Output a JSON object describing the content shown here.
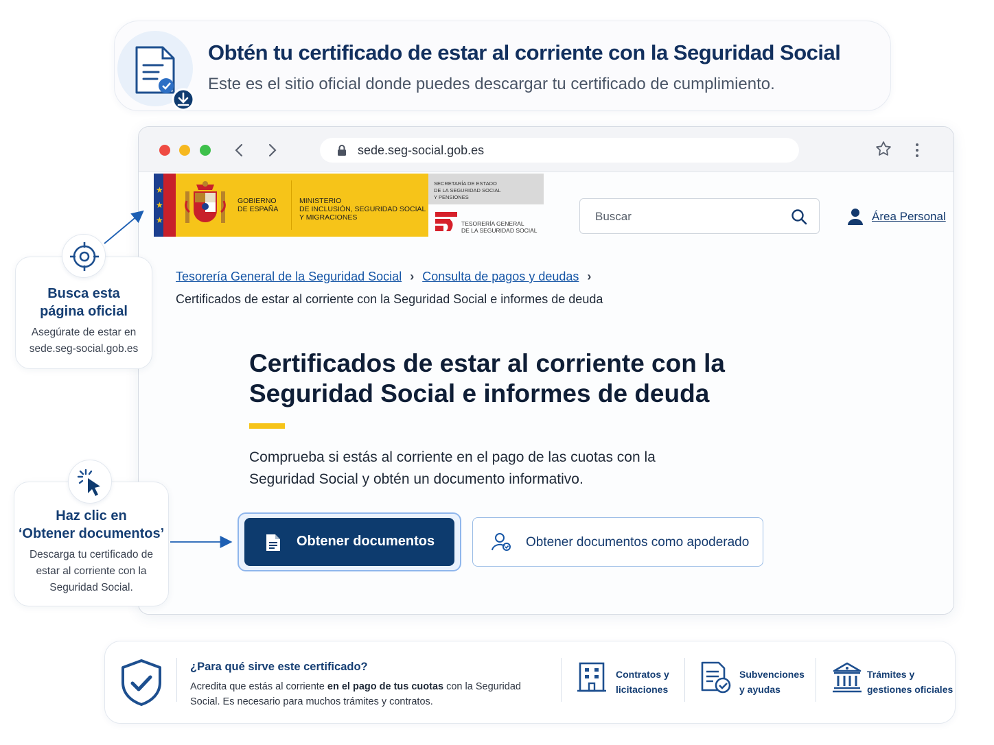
{
  "banner": {
    "title": "Obtén tu certificado de estar al corriente con la Seguridad Social",
    "subtitle": "Este es el sitio oficial donde puedes descargar tu certificado de cumplimiento.",
    "icon": "certificate-download-icon"
  },
  "browser": {
    "url": "sede.seg-social.gob.es",
    "back_icon": "chevron-left-icon",
    "forward_icon": "chevron-right-icon",
    "lock_icon": "lock-icon",
    "bookmark_icon": "star-icon",
    "menu_icon": "kebab-menu-icon"
  },
  "site_header": {
    "gov_line1": "GOBIERNO",
    "gov_line2": "DE ESPAÑA",
    "ministry_line1": "MINISTERIO",
    "ministry_line2": "DE INCLUSIÓN, SEGURIDAD SOCIAL",
    "ministry_line3": "Y MIGRACIONES",
    "secretaria_line1": "SECRETARÍA DE ESTADO",
    "secretaria_line2": "DE LA SEGURIDAD SOCIAL",
    "secretaria_line3": "Y PENSIONES",
    "tgss_line1": "TESORERÍA GENERAL",
    "tgss_line2": "DE LA SEGURIDAD SOCIAL",
    "search_placeholder": "Buscar",
    "area_personal": "Área Personal"
  },
  "breadcrumb": {
    "items": [
      "Tesorería General de la Seguridad Social",
      "Consulta de pagos y deudas"
    ],
    "separator": "›",
    "current": "Certificados de estar al corriente con la Seguridad Social e informes de deuda"
  },
  "main": {
    "title": "Certificados de estar al corriente con la Seguridad Social e informes de deuda",
    "lead": "Comprueba si estás al corriente en el pago de las cuotas con la Seguridad Social y obtén un documento informativo.",
    "primary_button": "Obtener documentos",
    "secondary_button": "Obtener documentos como apoderado"
  },
  "callouts": [
    {
      "icon": "target-icon",
      "title_line1": "Busca esta",
      "title_line2": "página oficial",
      "body_line1": "Asegúrate de estar en",
      "body_line2": "sede.seg-social.gob.es"
    },
    {
      "icon": "click-cursor-icon",
      "title_line1": "Haz clic en",
      "title_line2": "‘Obtener documentos’",
      "body_line1": "Descarga tu certificado de",
      "body_line2": "estar al corriente con la",
      "body_line3": "Seguridad Social."
    }
  ],
  "info_bar": {
    "icon": "shield-check-icon",
    "title": "¿Para qué sirve este certificado?",
    "body_pre": "Acredita que estás al corriente ",
    "body_bold": "en el pago de tus cuotas",
    "body_post": " con la Seguridad Social. Es necesario para muchos trámites y contratos.",
    "features": [
      {
        "icon": "building-icon",
        "line1": "Contratos y",
        "line2": "licitaciones"
      },
      {
        "icon": "document-check-icon",
        "line1": "Subvenciones",
        "line2": "y ayudas"
      },
      {
        "icon": "institution-icon",
        "line1": "Trámites y",
        "line2": "gestiones oficiales"
      }
    ]
  },
  "colors": {
    "navy": "#0d3b6e",
    "heading": "#153e73",
    "link": "#1656a6",
    "accent_yellow": "#f6c419",
    "spain_red": "#c8202a"
  }
}
